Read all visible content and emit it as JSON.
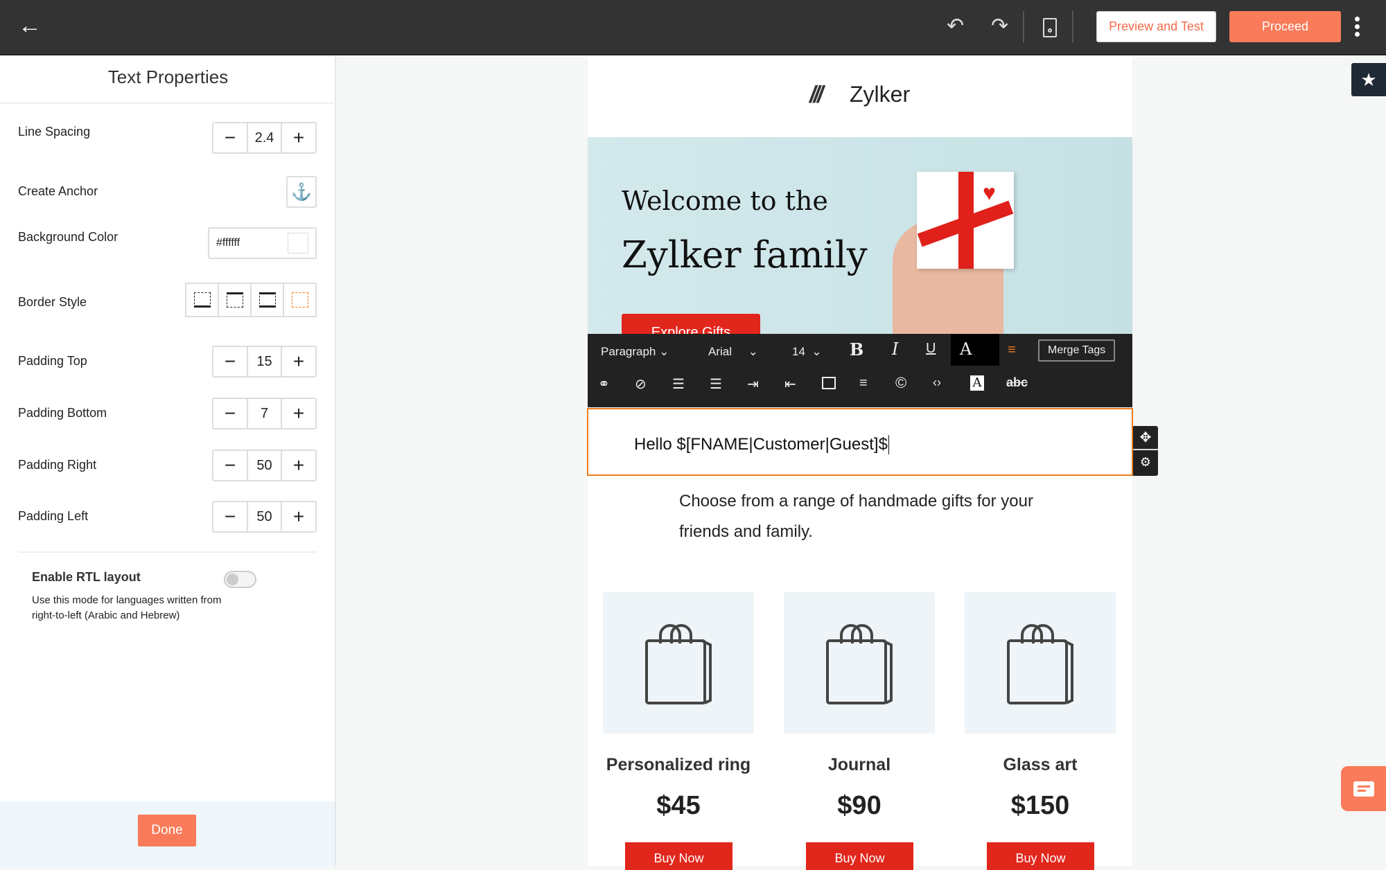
{
  "topbar": {
    "preview_label": "Preview and Test",
    "proceed_label": "Proceed"
  },
  "panel": {
    "title": "Text Properties",
    "line_spacing": {
      "label": "Line Spacing",
      "value": "2.4"
    },
    "anchor": {
      "label": "Create Anchor"
    },
    "bg_color": {
      "label": "Background Color",
      "value": "#ffffff"
    },
    "border_style": {
      "label": "Border Style"
    },
    "padding_top": {
      "label": "Padding Top",
      "value": "15"
    },
    "padding_bottom": {
      "label": "Padding Bottom",
      "value": "7"
    },
    "padding_right": {
      "label": "Padding Right",
      "value": "50"
    },
    "padding_left": {
      "label": "Padding Left",
      "value": "50"
    },
    "rtl": {
      "label": "Enable RTL layout",
      "description_1": "Use this mode for languages written from",
      "description_2": "right-to-left (Arabic and Hebrew)",
      "enabled": false
    },
    "done_label": "Done"
  },
  "email": {
    "brand": "Zylker",
    "hero_line1": "Welcome to the",
    "hero_line2": "Zylker family",
    "hero_button": "Explore Gifts",
    "greeting": "Hello $[FNAME|Customer|Guest]$",
    "intro_1": "Choose from a range of handmade gifts for your",
    "intro_2": "friends and family.",
    "products": [
      {
        "name": "Personalized ring",
        "price": "$45",
        "button": "Buy Now"
      },
      {
        "name": "Journal",
        "price": "$90",
        "button": "Buy Now"
      },
      {
        "name": "Glass art",
        "price": "$150",
        "button": "Buy Now"
      }
    ]
  },
  "toolbar": {
    "block_type": "Paragraph",
    "font": "Arial",
    "size": "14",
    "merge_tags": "Merge Tags",
    "bold": "B",
    "italic": "I",
    "underline": "U",
    "font_color": "A",
    "strike": "abc"
  },
  "colors": {
    "accent": "#f97b5a",
    "selection": "#f07b1d",
    "buy": "#e1261c"
  }
}
